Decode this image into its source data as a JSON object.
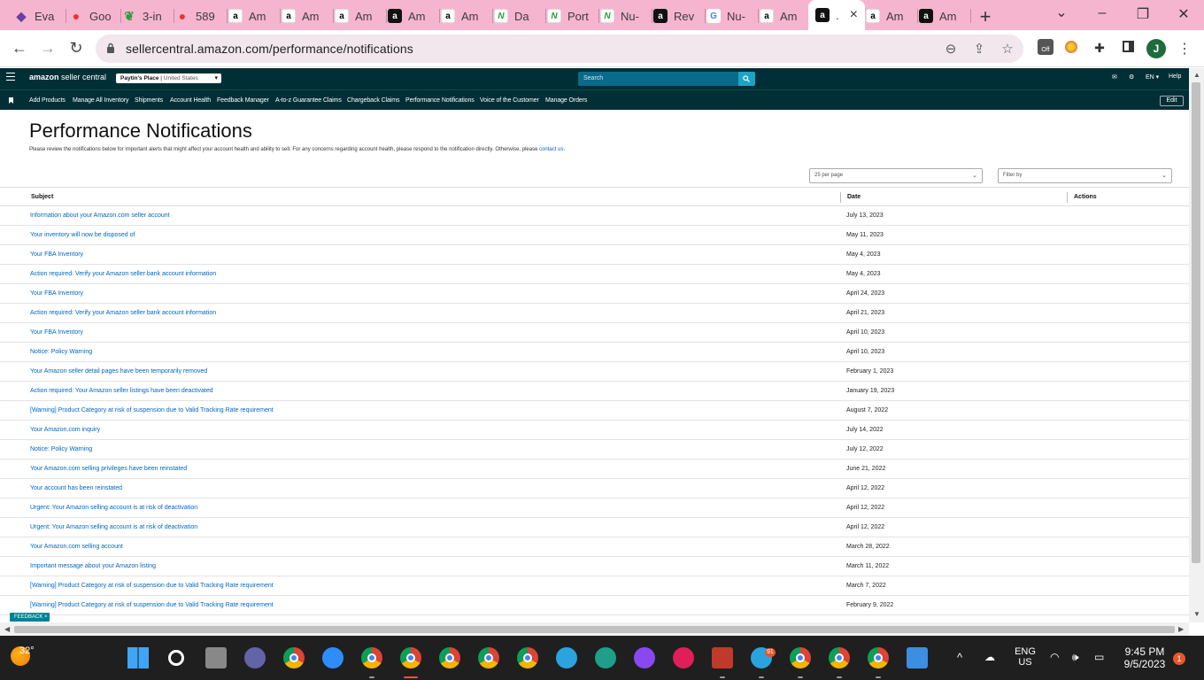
{
  "browser": {
    "tabs": [
      {
        "label": "Eva",
        "icon": "evx-icon"
      },
      {
        "label": "Goo",
        "icon": "google-maps-icon"
      },
      {
        "label": "3-in",
        "icon": "leaf-icon"
      },
      {
        "label": "589",
        "icon": "google-maps-icon"
      },
      {
        "label": "Am",
        "icon": "amazon-icon"
      },
      {
        "label": "Am",
        "icon": "amazon-icon"
      },
      {
        "label": "Am",
        "icon": "amazon-icon"
      },
      {
        "label": "Am",
        "icon": "amazon-dark-icon"
      },
      {
        "label": "Am",
        "icon": "amazon-icon"
      },
      {
        "label": "Da",
        "icon": "nu-icon"
      },
      {
        "label": "Port",
        "icon": "nu-icon"
      },
      {
        "label": "Nu-",
        "icon": "nu-icon"
      },
      {
        "label": "Rev",
        "icon": "amazon-dark-icon"
      },
      {
        "label": "Nu-",
        "icon": "google-icon"
      },
      {
        "label": "Am",
        "icon": "amazon-icon"
      },
      {
        "label": ".",
        "icon": "amazon-dark-icon",
        "active": true
      },
      {
        "label": "Am",
        "icon": "amazon-icon"
      },
      {
        "label": "Am",
        "icon": "amazon-dark-icon"
      }
    ],
    "url": "sellercentral.amazon.com/performance/notifications",
    "profile_initial": "J",
    "extension_badge": "Off"
  },
  "header": {
    "logo_bold": "amazon",
    "logo_rest": " seller central",
    "store_name": "Paytin's Place",
    "marketplace": "United States",
    "search_placeholder": "Search",
    "language": "EN",
    "help": "Help"
  },
  "nav": {
    "links": [
      "Add Products",
      "Manage All Inventory",
      "Shipments",
      "Account Health",
      "Feedback Manager",
      "A-to-z Guarantee Claims",
      "Chargeback Claims",
      "Performance Notifications",
      "Voice of the Customer",
      "Manage Orders"
    ],
    "edit_label": "Edit"
  },
  "page": {
    "title": "Performance Notifications",
    "description": "Please review the notifications below for important alerts that might affect your account health and ability to sell. For any concerns regarding account health, please respond to the notification directly. Otherwise, please ",
    "contact_link": "contact us",
    "description_end": ".",
    "per_page": "25 per page",
    "filter_placeholder": "Filter by"
  },
  "table": {
    "columns": [
      "Subject",
      "Date",
      "Actions"
    ],
    "rows": [
      {
        "subject": "Information about your Amazon.com seller account",
        "date": "July 13, 2023"
      },
      {
        "subject": "Your inventory will now be disposed of",
        "date": "May 11, 2023"
      },
      {
        "subject": "Your FBA Inventory",
        "date": "May 4, 2023"
      },
      {
        "subject": "Action required: Verify your Amazon seller bank account information",
        "date": "May 4, 2023"
      },
      {
        "subject": "Your FBA Inventory",
        "date": "April 24, 2023"
      },
      {
        "subject": "Action required: Verify your Amazon seller bank account information",
        "date": "April 21, 2023"
      },
      {
        "subject": "Your FBA Inventory",
        "date": "April 10, 2023"
      },
      {
        "subject": "Notice: Policy Warning",
        "date": "April 10, 2023"
      },
      {
        "subject": "Your Amazon seller detail pages have been temporarily removed",
        "date": "February 1, 2023"
      },
      {
        "subject": "Action required: Your Amazon seller listings have been deactivated",
        "date": "January 19, 2023"
      },
      {
        "subject": "[Warning] Product Category at risk of suspension due to Valid Tracking Rate requirement",
        "date": "August 7, 2022"
      },
      {
        "subject": "Your Amazon.com inquiry",
        "date": "July 14, 2022"
      },
      {
        "subject": "Notice: Policy Warning",
        "date": "July 12, 2022"
      },
      {
        "subject": "Your Amazon.com selling privileges have been reinstated",
        "date": "June 21, 2022"
      },
      {
        "subject": "Your account has been reinstated",
        "date": "April 12, 2022"
      },
      {
        "subject": "Urgent: Your Amazon selling account is at risk of deactivation",
        "date": "April 12, 2022"
      },
      {
        "subject": "Urgent: Your Amazon selling account is at risk of deactivation",
        "date": "April 12, 2022"
      },
      {
        "subject": "Your Amazon.com selling account",
        "date": "March 28, 2022"
      },
      {
        "subject": "Important message about your Amazon listing",
        "date": "March 11, 2022"
      },
      {
        "subject": "[Warning] Product Category at risk of suspension due to Valid Tracking Rate requirement",
        "date": "March 7, 2022"
      },
      {
        "subject": "[Warning] Product Category at risk of suspension due to Valid Tracking Rate requirement",
        "date": "February 9, 2022"
      }
    ]
  },
  "feedback_label": "FEEDBACK",
  "taskbar": {
    "temperature": "32°",
    "language_line1": "ENG",
    "language_line2": "US",
    "time": "9:45 PM",
    "date": "9/5/2023",
    "notification_count": "1",
    "telegram_badge": "91"
  },
  "colors": {
    "tab_strip": "#f6b5cf",
    "seller_header": "#002f36",
    "link": "#0066c0",
    "search_button": "#1fa3c5",
    "feedback": "#008296"
  }
}
